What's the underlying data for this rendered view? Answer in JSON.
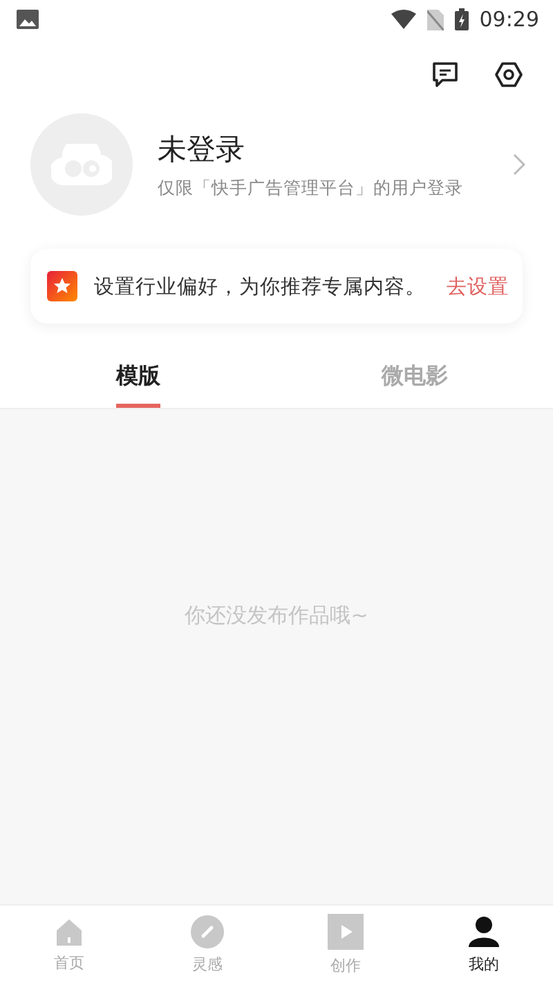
{
  "status_bar": {
    "time": "09:29"
  },
  "profile": {
    "name": "未登录",
    "subtitle": "仅限「快手广告管理平台」的用户登录"
  },
  "banner": {
    "text": "设置行业偏好，为你推荐专属内容。",
    "action": "去设置"
  },
  "tabs": [
    {
      "label": "模版",
      "selected": true
    },
    {
      "label": "微电影",
      "selected": false
    }
  ],
  "empty_message": "你还没发布作品哦~",
  "bottom_nav": [
    {
      "label": "首页",
      "kind": "home",
      "selected": false
    },
    {
      "label": "灵感",
      "kind": "inspire",
      "selected": false
    },
    {
      "label": "创作",
      "kind": "create",
      "selected": false
    },
    {
      "label": "我的",
      "kind": "me",
      "selected": true
    }
  ]
}
